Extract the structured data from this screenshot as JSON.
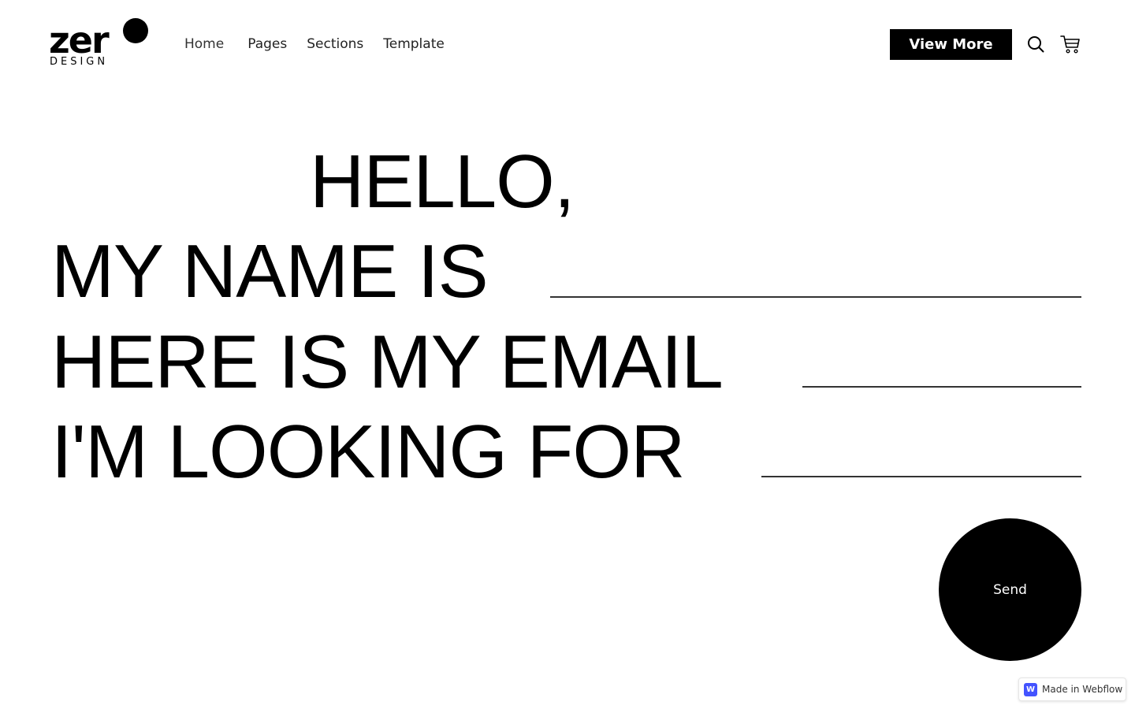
{
  "brand": {
    "name": "zer",
    "sub": "DESIGN"
  },
  "nav": {
    "home": "Home",
    "pages": "Pages",
    "sections": "Sections",
    "template": "Template"
  },
  "header": {
    "cta_label": "View More",
    "search_icon": "search-icon",
    "cart_icon": "cart-icon"
  },
  "form": {
    "greeting": "HELLO,",
    "name_label": "MY NAME IS",
    "name_value": "",
    "email_label": "HERE IS MY EMAIL",
    "email_value": "",
    "looking_label": "I'M LOOKING FOR",
    "looking_value": "",
    "submit_label": "Send"
  },
  "badge": {
    "label": "Made in Webflow",
    "logo_letter": "W"
  },
  "colors": {
    "primary": "#000000",
    "background": "#ffffff",
    "webflow_blue": "#4353ff"
  }
}
